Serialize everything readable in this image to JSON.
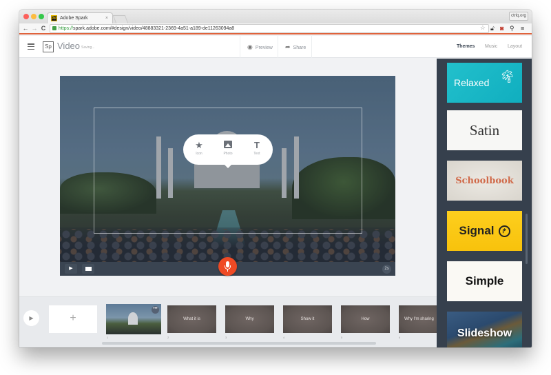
{
  "browser": {
    "tab_title": "Adobe Spark",
    "tab_close": "×",
    "favicon": "Sp",
    "profile": "ctrlq.org",
    "url_scheme": "https://",
    "url_rest": "spark.adobe.com/#design/video/48883321-2369-4a51-a189-de11263094a8",
    "nav": {
      "back": "←",
      "forward": "→",
      "reload": "C"
    },
    "icons": [
      "star-icon",
      "lock-icon",
      "pocket-icon",
      "extension-icon",
      "menu-icon"
    ]
  },
  "header": {
    "logo": "Sp",
    "app_name": "Video",
    "status": "Saving...",
    "preview_label": "Preview",
    "share_label": "Share",
    "sidebar_tabs": [
      {
        "label": "Themes",
        "active": true
      },
      {
        "label": "Music",
        "active": false
      },
      {
        "label": "Layout",
        "active": false
      }
    ]
  },
  "canvas": {
    "popover": [
      {
        "icon": "star-icon",
        "glyph": "★",
        "label": "Icon"
      },
      {
        "icon": "photo-icon",
        "glyph": "",
        "label": "Photo"
      },
      {
        "icon": "text-icon",
        "glyph": "T",
        "label": "Text"
      }
    ],
    "controls": {
      "play_glyph": "▶",
      "duration": "2s"
    }
  },
  "timeline": {
    "play_glyph": "▶",
    "add_glyph": "+",
    "slides": [
      {
        "number": "1",
        "title": "",
        "type": "photo"
      },
      {
        "number": "2",
        "title": "What it is"
      },
      {
        "number": "3",
        "title": "Why"
      },
      {
        "number": "4",
        "title": "Show it"
      },
      {
        "number": "5",
        "title": "How"
      },
      {
        "number": "6",
        "title": "Why I'm sharing"
      }
    ],
    "more_glyph": "•••"
  },
  "themes": [
    {
      "name": "Relaxed",
      "color": "#19b8c6"
    },
    {
      "name": "Satin",
      "color": "#f7f7f5"
    },
    {
      "name": "Schoolbook",
      "color": "#d06a4a"
    },
    {
      "name": "Signal",
      "color": "#fbc815"
    },
    {
      "name": "Simple",
      "color": "#faf9f4"
    },
    {
      "name": "Slideshow",
      "color": "#2b4a6e"
    }
  ],
  "colors": {
    "accent_red": "#ef4a24",
    "sidebar_bg": "#36404d",
    "address_bar_accent": "#e0633c"
  }
}
